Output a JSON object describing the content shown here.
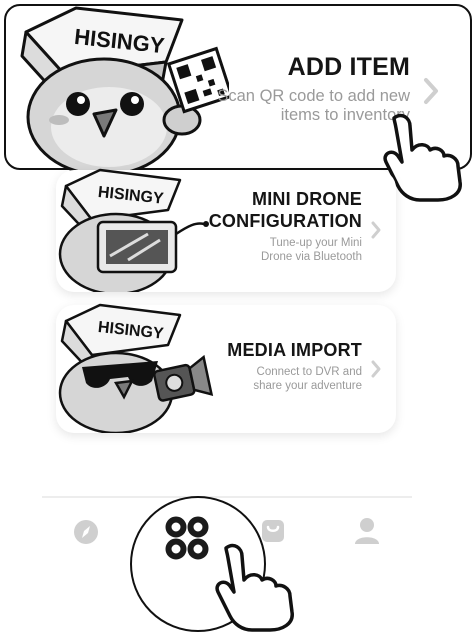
{
  "cards": [
    {
      "brand": "HISINGY",
      "title": "ADD ITEM",
      "description": "Scan QR code to add new items to inventory",
      "icon": "qr-code-icon"
    },
    {
      "brand": "HISINGY",
      "title_line1": "MINI DRONE",
      "title_line2": "CONFIGURATION",
      "description_line1": "Tune-up your Mini",
      "description_line2": "Drone via Bluetooth",
      "icon": "drone-screen-icon"
    },
    {
      "brand": "HISINGY",
      "title": "MEDIA IMPORT",
      "description_line1": "Connect to DVR and",
      "description_line2": "share your adventure",
      "icon": "camera-icon"
    }
  ],
  "tabbar": {
    "items": [
      "compass-icon",
      "apps-icon",
      "bag-icon",
      "profile-icon"
    ],
    "active": "apps-icon"
  },
  "colors": {
    "icon_gray": "#cfcfcf",
    "active_icon": "#1b1b1b",
    "description": "#9a9a9a"
  }
}
